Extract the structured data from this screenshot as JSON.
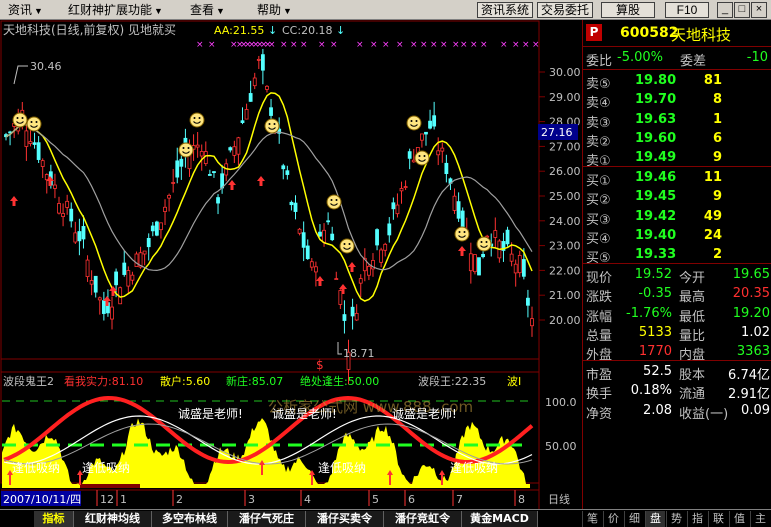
{
  "menubar": {
    "menus": [
      {
        "label": "资讯",
        "arrow": "▼"
      },
      {
        "label": "红财神扩展功能",
        "arrow": "▼"
      },
      {
        "label": "查看",
        "arrow": "▼"
      },
      {
        "label": "帮助",
        "arrow": "▼"
      }
    ],
    "buttons": [
      "资讯系统",
      "交易委托",
      "算股",
      "F10"
    ],
    "win": {
      "min": "_",
      "max": "□",
      "close": "×"
    }
  },
  "chart": {
    "title": "天地科技(日线,前复权) 见地就买",
    "aa_label": "AA:21.55",
    "cc_label": "CC:20.18",
    "arrow_down": "↓",
    "price_ticks": [
      "30.00",
      "29.00",
      "28.00",
      "27.00",
      "26.00",
      "25.00",
      "24.00",
      "23.00",
      "22.00",
      "21.00",
      "20.00"
    ],
    "current_price": "27.16",
    "high_label": "30.46",
    "low_label": "18.71",
    "dollar_mark": "$",
    "indicator_labels": [
      {
        "text": "波段鬼王2",
        "color": "#c0c0c0"
      },
      {
        "text": "看我实力:81.10",
        "color": "#ff3030"
      },
      {
        "text": "散户:5.60",
        "color": "#ffff00"
      },
      {
        "text": "新庄:85.07",
        "color": "#20ff20"
      },
      {
        "text": "绝处逢生:50.00",
        "color": "#20ff20"
      },
      {
        "text": "波段王:22.35",
        "color": "#c0c0c0"
      },
      {
        "text": "波I",
        "color": "#ffff00"
      }
    ],
    "ind_ticks": [
      "100.0",
      "50.00"
    ],
    "ind_texts": [
      "诚盛是老师!",
      "诚盛是老师!",
      "诚盛是老师!"
    ],
    "ind_dip_texts": [
      "逢低吸纳",
      "逢低吸纳",
      "逢低吸纳",
      "逢低吸纳"
    ],
    "watermark": "公析家公式网 www.888 .com",
    "date_label": "2007/10/11/四",
    "months": [
      "12",
      "1",
      "2",
      "3",
      "4",
      "5",
      "6",
      "7",
      "8"
    ],
    "period": "日线"
  },
  "quote": {
    "marker": "P",
    "code": "600582",
    "name": "天地科技",
    "wb": {
      "label": "委比",
      "value": "-5.00%",
      "label2": "委差",
      "value2": "-10"
    },
    "sells": [
      {
        "label": "卖⑤",
        "price": "19.80",
        "vol": "81"
      },
      {
        "label": "卖④",
        "price": "19.70",
        "vol": "8"
      },
      {
        "label": "卖③",
        "price": "19.63",
        "vol": "1"
      },
      {
        "label": "卖②",
        "price": "19.60",
        "vol": "6"
      },
      {
        "label": "卖①",
        "price": "19.49",
        "vol": "9"
      }
    ],
    "buys": [
      {
        "label": "买①",
        "price": "19.46",
        "vol": "11"
      },
      {
        "label": "买②",
        "price": "19.45",
        "vol": "9"
      },
      {
        "label": "买③",
        "price": "19.42",
        "vol": "49"
      },
      {
        "label": "买④",
        "price": "19.40",
        "vol": "24"
      },
      {
        "label": "买⑤",
        "price": "19.33",
        "vol": "2"
      }
    ],
    "stats1": [
      {
        "l1": "现价",
        "v1": "19.52",
        "c1": "#20ff20",
        "l2": "今开",
        "v2": "19.65",
        "c2": "#20ff20"
      },
      {
        "l1": "涨跌",
        "v1": "-0.35",
        "c1": "#20ff20",
        "l2": "最高",
        "v2": "20.35",
        "c2": "#ff3030"
      },
      {
        "l1": "涨幅",
        "v1": "-1.76%",
        "c1": "#20ff20",
        "l2": "最低",
        "v2": "19.20",
        "c2": "#20ff20"
      },
      {
        "l1": "总量",
        "v1": "5133",
        "c1": "#ffff00",
        "l2": "量比",
        "v2": "1.02",
        "c2": "#ffffff"
      },
      {
        "l1": "外盘",
        "v1": "1770",
        "c1": "#ff3030",
        "l2": "内盘",
        "v2": "3363",
        "c2": "#20ff20"
      }
    ],
    "stats2": [
      {
        "l1": "市盈",
        "v1": "52.5",
        "l2": "股本",
        "v2": "6.74亿"
      },
      {
        "l1": "换手",
        "v1": "0.18%",
        "l2": "流通",
        "v2": "2.91亿"
      },
      {
        "l1": "净资",
        "v1": "2.08",
        "l2": "收益(一)",
        "v2": "0.09"
      }
    ]
  },
  "bottom": {
    "tabs": [
      "指标",
      "红财神均线",
      "多空布林线",
      "潘仔气死庄",
      "潘仔买卖令",
      "潘仔竞虹令",
      "黄金MACD"
    ],
    "right": [
      "笔",
      "价",
      "细",
      "盘",
      "势",
      "指",
      "联",
      "值",
      "主"
    ]
  },
  "colors": {
    "up": "#ff3232",
    "down": "#54ffff",
    "ma_yellow": "#ffff00",
    "ma_gray": "#a0a0a0",
    "grid": "#800000"
  }
}
